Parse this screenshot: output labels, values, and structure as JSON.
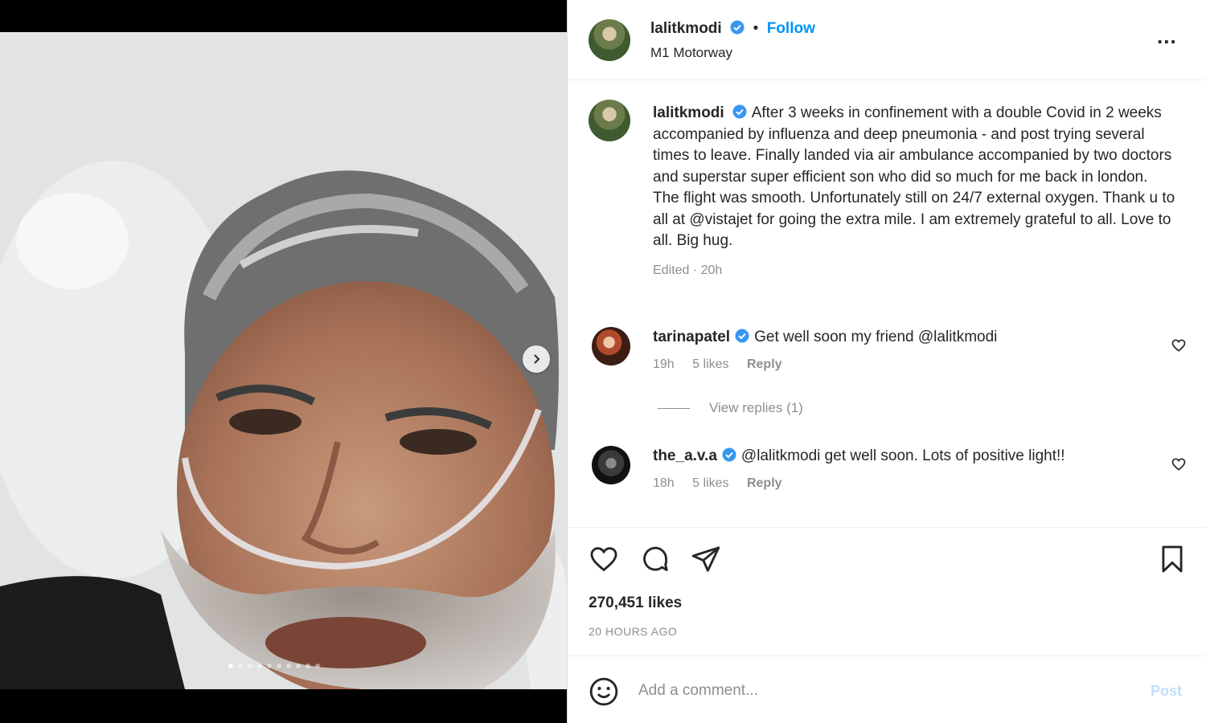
{
  "post": {
    "username": "lalitkmodi",
    "follow_label": "Follow",
    "location": "M1 Motorway",
    "more_label": "...",
    "caption": "After 3 weeks in confinement with a double Covid in 2 weeks accompanied by influenza and deep pneumonia - and post trying several times to leave. Finally landed via air ambulance accompanied by two doctors and superstar super efficient son who did so much for me back in london. The flight was smooth. Unfortunately still on 24/7 external oxygen. Thank u to all at @vistajet for going the extra mile. I am extremely grateful to all. Love to all. Big hug.",
    "edited": "Edited · 20h",
    "likes": "270,451 likes",
    "time_ago": "20 HOURS AGO"
  },
  "comments": [
    {
      "username": "tarinapatel",
      "text": "Get well soon my friend @lalitkmodi",
      "time": "19h",
      "likes": "5 likes",
      "reply": "Reply"
    },
    {
      "username": "the_a.v.a",
      "text": "@lalitkmodi get well soon. Lots of positive light!!",
      "time": "18h",
      "likes": "5 likes",
      "reply": "Reply"
    }
  ],
  "view_replies": "View replies (1)",
  "add_comment": {
    "placeholder": "Add a comment...",
    "post_label": "Post"
  },
  "carousel": {
    "current": 1,
    "total": 10
  },
  "colors": {
    "accent": "#0095f6",
    "verified": "#3897f0",
    "muted": "#8e8e8e"
  },
  "icons": [
    "verified-icon",
    "more-icon",
    "chevron-right-icon",
    "heart-icon",
    "comment-icon",
    "share-icon",
    "bookmark-icon",
    "emoji-icon"
  ]
}
